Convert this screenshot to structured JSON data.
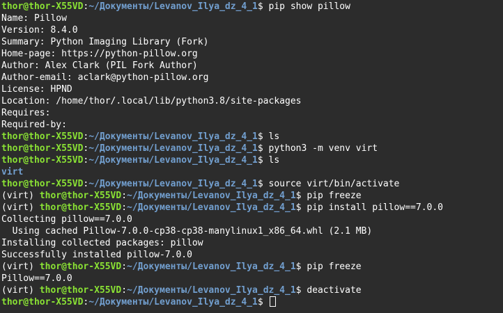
{
  "prompt": {
    "user_host": "thor@thor-X55VD",
    "colon": ":",
    "path": "~/Документы/Levanov_Ilya_dz_4_1",
    "symbol": "$ ",
    "venv_prefix": "(virt) "
  },
  "colors": {
    "background": "#2c2c2c",
    "user_host": "#8ae234",
    "path": "#729fcf",
    "text": "#ffffff"
  },
  "lines": [
    {
      "type": "prompt",
      "cmd": "pip show pillow"
    },
    {
      "type": "out",
      "text": "Name: Pillow"
    },
    {
      "type": "out",
      "text": "Version: 8.4.0"
    },
    {
      "type": "out",
      "text": "Summary: Python Imaging Library (Fork)"
    },
    {
      "type": "out",
      "text": "Home-page: https://python-pillow.org"
    },
    {
      "type": "out",
      "text": "Author: Alex Clark (PIL Fork Author)"
    },
    {
      "type": "out",
      "text": "Author-email: aclark@python-pillow.org"
    },
    {
      "type": "out",
      "text": "License: HPND"
    },
    {
      "type": "out",
      "text": "Location: /home/thor/.local/lib/python3.8/site-packages"
    },
    {
      "type": "out",
      "text": "Requires:"
    },
    {
      "type": "out",
      "text": "Required-by:"
    },
    {
      "type": "prompt",
      "cmd": "ls"
    },
    {
      "type": "prompt",
      "cmd": "python3 -m venv virt"
    },
    {
      "type": "prompt",
      "cmd": "ls"
    },
    {
      "type": "dir",
      "text": "virt"
    },
    {
      "type": "prompt",
      "cmd": "source virt/bin/activate"
    },
    {
      "type": "venvprompt",
      "cmd": "pip freeze"
    },
    {
      "type": "venvprompt",
      "cmd": "pip install pillow==7.0.0"
    },
    {
      "type": "out",
      "text": "Collecting pillow==7.0.0"
    },
    {
      "type": "out",
      "text": "  Using cached Pillow-7.0.0-cp38-cp38-manylinux1_x86_64.whl (2.1 MB)"
    },
    {
      "type": "out",
      "text": "Installing collected packages: pillow"
    },
    {
      "type": "out",
      "text": "Successfully installed pillow-7.0.0"
    },
    {
      "type": "venvprompt",
      "cmd": "pip freeze"
    },
    {
      "type": "out",
      "text": "Pillow==7.0.0"
    },
    {
      "type": "venvprompt",
      "cmd": "deactivate"
    },
    {
      "type": "prompt",
      "cmd": "",
      "cursor": true
    }
  ]
}
